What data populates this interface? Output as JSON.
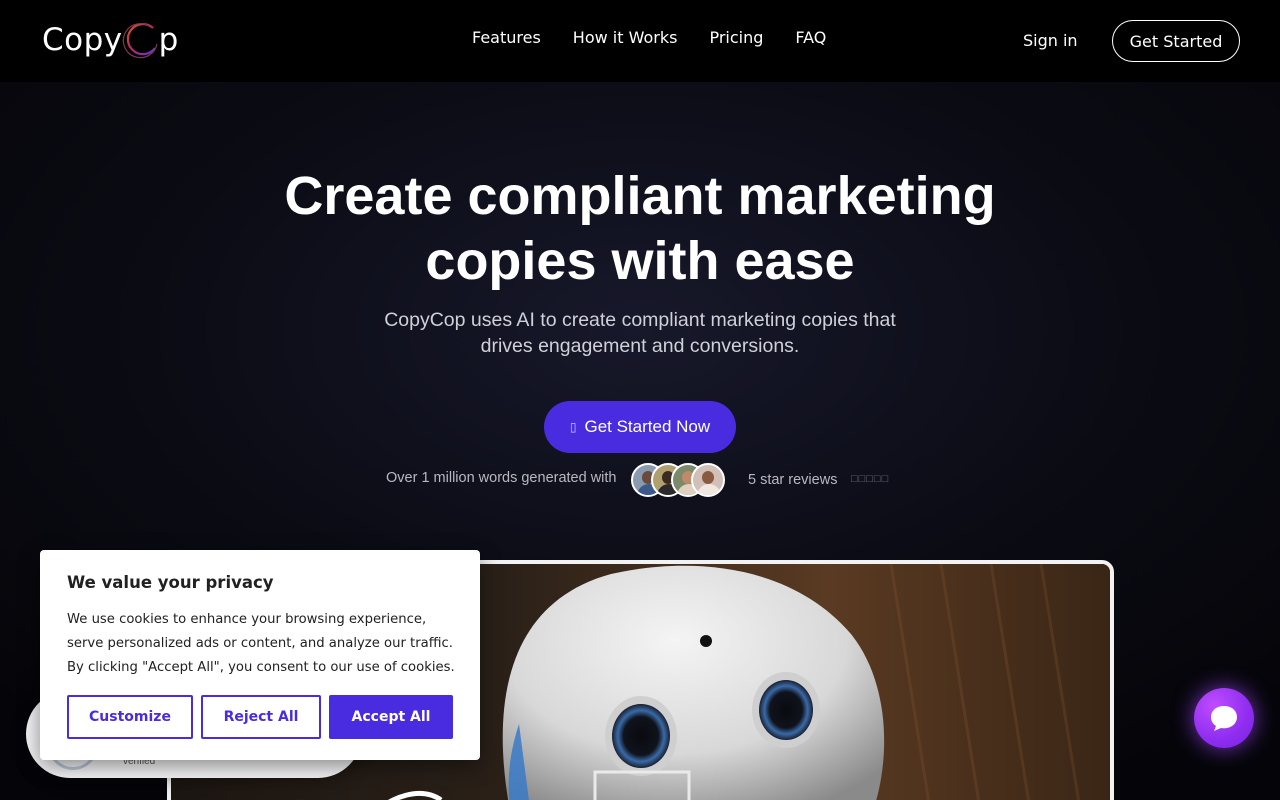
{
  "header": {
    "logo_text_left": "Copy",
    "logo_text_right": "p",
    "nav": [
      "Features",
      "How it Works",
      "Pricing",
      "FAQ"
    ],
    "sign_in": "Sign in",
    "get_started": "Get Started"
  },
  "hero": {
    "title_line1": "Create compliant marketing",
    "title_line2": "copies with ease",
    "subtitle_line1": "CopyCop uses AI to create compliant marketing copies that",
    "subtitle_line2": "drives engagement and conversions.",
    "cta_label": "Get Started Now",
    "cta_icon": "rocket-icon",
    "social_proof": "Over 1 million words generated with",
    "reviews_label": "5 star reviews",
    "stars": "□□□□□"
  },
  "badge": {
    "verified_text": "verified"
  },
  "cookie": {
    "title": "We value your privacy",
    "body": "We use cookies to enhance your browsing experience, serve personalized ads or content, and analyze our traffic. By clicking \"Accept All\", you consent to our use of cookies.",
    "customize": "Customize",
    "reject": "Reject All",
    "accept": "Accept All"
  },
  "colors": {
    "accent": "#4a2ce0",
    "chat_bubble": "#9a36f2",
    "background": "#050509"
  }
}
